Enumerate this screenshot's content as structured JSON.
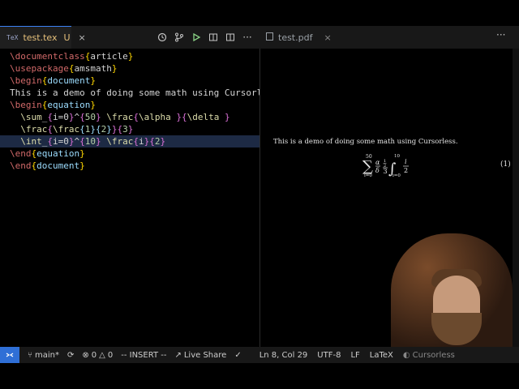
{
  "editor_tab": {
    "icon_text": "TeX",
    "filename": "test.tex",
    "status": "U",
    "close": "×"
  },
  "toolbar": {
    "icons": [
      "history-icon",
      "source-control-icon",
      "run-icon",
      "open-preview-icon",
      "split-editor-icon",
      "more-icon"
    ],
    "more": "···"
  },
  "pdf_tab": {
    "filename": "test.pdf",
    "close": "×"
  },
  "right_more": "···",
  "code_lines": [
    "\\documentclass{article}",
    "\\usepackage{amsmath}",
    "\\begin{document}",
    "This is a demo of doing some math using Cursorless",
    "\\begin{equation}",
    "  \\sum_{i=0}^{50} \\frac{\\alpha }{\\delta }",
    "  \\frac{\\frac{1}{2}}{3}",
    "  \\int_{i=0}^{10} \\frac{i}{2}",
    "\\end{equation}",
    "\\end{document}"
  ],
  "pdf": {
    "text": "This is a demo of doing some math using Cursorless.",
    "equation_number": "(1)",
    "sum_upper": "50",
    "sum_lower": "i=0",
    "alpha": "α",
    "delta": "δ",
    "half_num": "1",
    "half_den": "2",
    "three": "3",
    "int_upper": "10",
    "int_lower": "i=0",
    "i_num": "i",
    "i_den": "2"
  },
  "status": {
    "branch": "main*",
    "errors": "0",
    "warnings": "0",
    "mode": "-- INSERT --",
    "live_share": "Live Share",
    "position": "Ln 8, Col 29",
    "encoding": "UTF-8",
    "eol": "LF",
    "language": "LaTeX",
    "extension": "Cursorless"
  }
}
